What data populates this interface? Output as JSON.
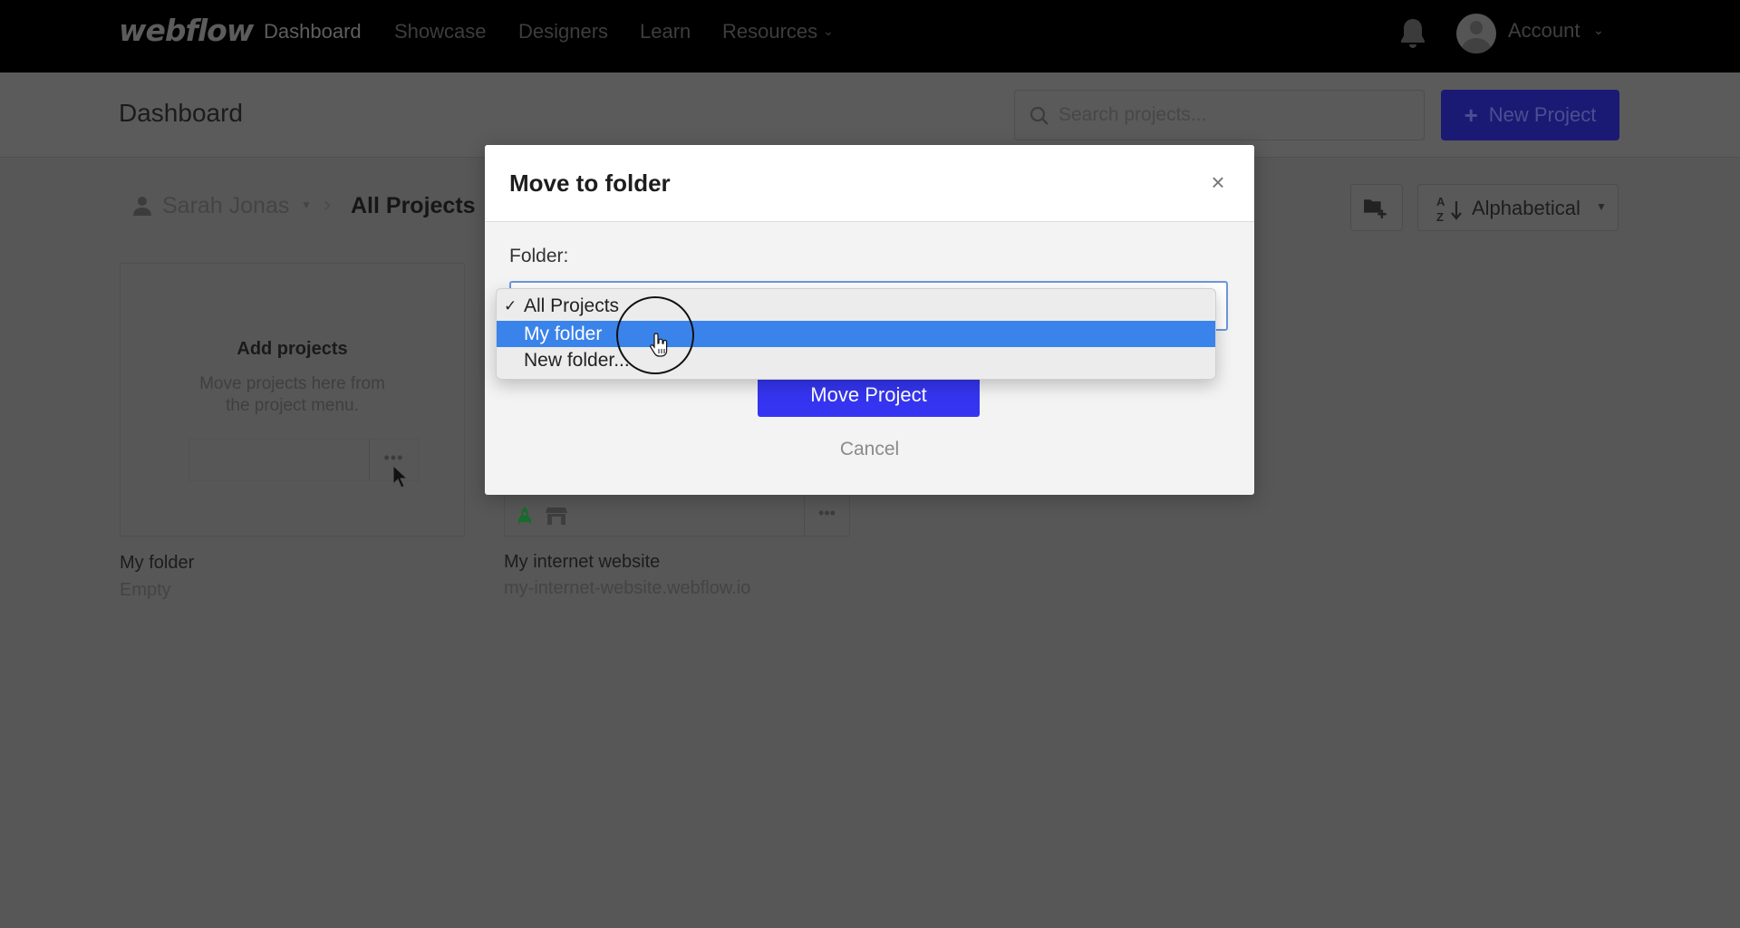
{
  "nav": {
    "logo": "webflow",
    "links": [
      {
        "label": "Dashboard",
        "active": true
      },
      {
        "label": "Showcase",
        "active": false
      },
      {
        "label": "Designers",
        "active": false
      },
      {
        "label": "Learn",
        "active": false
      },
      {
        "label": "Resources",
        "active": false,
        "has_dropdown": true
      }
    ],
    "notification_icon": "bell-icon",
    "account_label": "Account",
    "account_chevron": "⌄"
  },
  "header": {
    "title": "Dashboard",
    "search_placeholder": "Search projects...",
    "new_project_label": "New Project",
    "new_project_icon": "+"
  },
  "breadcrumb": {
    "user": "Sarah Jonas",
    "user_caret": "▼",
    "separator": "›",
    "current": "All Projects"
  },
  "toolbar": {
    "new_folder_icon": "folder-plus-icon",
    "sort_label": "Alphabetical",
    "sort_caret": "▼"
  },
  "cards": [
    {
      "empty_title": "Add projects",
      "empty_desc_line1": "Move projects here from",
      "empty_desc_line2": "the project menu.",
      "more": "•••",
      "name": "My folder",
      "subtitle": "Empty"
    },
    {
      "more": "•••",
      "name": "My internet website",
      "subtitle": "my-internet-website.webflow.io"
    }
  ],
  "modal": {
    "title": "Move to folder",
    "close": "×",
    "folder_label": "Folder:",
    "submit_label": "Move Project",
    "cancel_label": "Cancel",
    "dropdown": {
      "options": [
        {
          "label": "All Projects",
          "checked": true,
          "highlighted": false
        },
        {
          "label": "My folder",
          "checked": false,
          "highlighted": true
        },
        {
          "label": "New folder...",
          "checked": false,
          "highlighted": false
        }
      ],
      "check_glyph": "✓"
    }
  },
  "colors": {
    "accent": "#3535f1",
    "highlight": "#3a83ea",
    "overlay": "#575757"
  }
}
